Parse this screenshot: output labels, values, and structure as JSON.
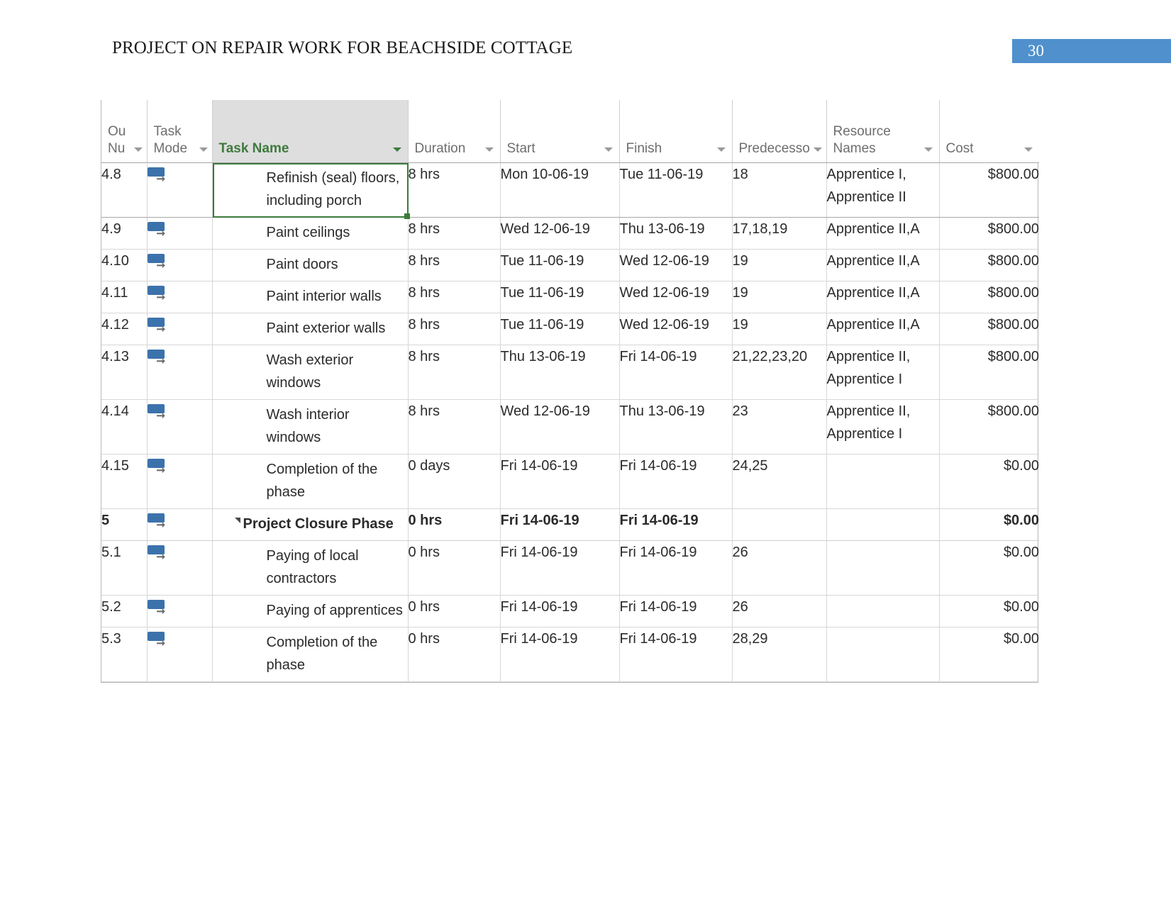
{
  "header": {
    "doc_title": "PROJECT ON REPAIR WORK FOR BEACHSIDE COTTAGE",
    "page_number": "30",
    "page_bar_color": "#4f90cd"
  },
  "table": {
    "selected_column": "Task Name",
    "selection_color": "#3b7a3b",
    "columns": [
      {
        "key": "outline",
        "label": "Ou\nNu",
        "has_filter": true
      },
      {
        "key": "task_mode",
        "label": "Task\nMode",
        "has_filter": true
      },
      {
        "key": "task_name",
        "label": "Task Name",
        "has_filter": true,
        "selected": true
      },
      {
        "key": "duration",
        "label": "Duration",
        "has_filter": true
      },
      {
        "key": "start",
        "label": "Start",
        "has_filter": true
      },
      {
        "key": "finish",
        "label": "Finish",
        "has_filter": true
      },
      {
        "key": "predecessor",
        "label": "Predecesso",
        "has_filter": true
      },
      {
        "key": "resources",
        "label": "Resource\nNames",
        "has_filter": true
      },
      {
        "key": "cost",
        "label": "Cost",
        "has_filter": true
      }
    ],
    "rows": [
      {
        "outline": "4.8",
        "mode_icon": "auto-schedule-icon",
        "task_name": "Refinish (seal) floors, including porch",
        "duration": "8 hrs",
        "start": "Mon 10-06-19",
        "finish": "Tue 11-06-19",
        "predecessor": "18",
        "resources": "Apprentice I, Apprentice II",
        "cost": "$800.00",
        "selected": true,
        "summary": false
      },
      {
        "outline": "4.9",
        "mode_icon": "auto-schedule-icon",
        "task_name": "Paint ceilings",
        "duration": "8 hrs",
        "start": "Wed 12-06-19",
        "finish": "Thu 13-06-19",
        "predecessor": "17,18,19",
        "resources": "Apprentice II,A",
        "cost": "$800.00",
        "selected": false,
        "summary": false
      },
      {
        "outline": "4.10",
        "mode_icon": "auto-schedule-icon",
        "task_name": "Paint doors",
        "duration": "8 hrs",
        "start": "Tue 11-06-19",
        "finish": "Wed 12-06-19",
        "predecessor": "19",
        "resources": "Apprentice II,A",
        "cost": "$800.00",
        "selected": false,
        "summary": false
      },
      {
        "outline": "4.11",
        "mode_icon": "auto-schedule-icon",
        "task_name": "Paint interior walls",
        "duration": "8 hrs",
        "start": "Tue 11-06-19",
        "finish": "Wed 12-06-19",
        "predecessor": "19",
        "resources": "Apprentice II,A",
        "cost": "$800.00",
        "selected": false,
        "summary": false
      },
      {
        "outline": "4.12",
        "mode_icon": "auto-schedule-icon",
        "task_name": "Paint exterior walls",
        "duration": "8 hrs",
        "start": "Tue 11-06-19",
        "finish": "Wed 12-06-19",
        "predecessor": "19",
        "resources": "Apprentice II,A",
        "cost": "$800.00",
        "selected": false,
        "summary": false
      },
      {
        "outline": "4.13",
        "mode_icon": "auto-schedule-icon",
        "task_name": "Wash exterior windows",
        "duration": "8 hrs",
        "start": "Thu 13-06-19",
        "finish": "Fri 14-06-19",
        "predecessor": "21,22,23,20",
        "resources": "Apprentice II, Apprentice I",
        "cost": "$800.00",
        "selected": false,
        "summary": false
      },
      {
        "outline": "4.14",
        "mode_icon": "auto-schedule-icon",
        "task_name": "Wash interior windows",
        "duration": "8 hrs",
        "start": "Wed 12-06-19",
        "finish": "Thu 13-06-19",
        "predecessor": "23",
        "resources": "Apprentice II, Apprentice I",
        "cost": "$800.00",
        "selected": false,
        "summary": false
      },
      {
        "outline": "4.15",
        "mode_icon": "auto-schedule-icon",
        "task_name": "Completion of the phase",
        "duration": "0 days",
        "start": "Fri 14-06-19",
        "finish": "Fri 14-06-19",
        "predecessor": "24,25",
        "resources": "",
        "cost": "$0.00",
        "selected": false,
        "summary": false
      },
      {
        "outline": "5",
        "mode_icon": "auto-schedule-icon",
        "task_name": "Project Closure Phase",
        "duration": "0 hrs",
        "start": "Fri 14-06-19",
        "finish": "Fri 14-06-19",
        "predecessor": "",
        "resources": "",
        "cost": "$0.00",
        "selected": false,
        "summary": true
      },
      {
        "outline": "5.1",
        "mode_icon": "auto-schedule-icon",
        "task_name": "Paying of local contractors",
        "duration": "0 hrs",
        "start": "Fri 14-06-19",
        "finish": "Fri 14-06-19",
        "predecessor": "26",
        "resources": "",
        "cost": "$0.00",
        "selected": false,
        "summary": false
      },
      {
        "outline": "5.2",
        "mode_icon": "auto-schedule-icon",
        "task_name": "Paying of apprentices",
        "duration": "0 hrs",
        "start": "Fri 14-06-19",
        "finish": "Fri 14-06-19",
        "predecessor": "26",
        "resources": "",
        "cost": "$0.00",
        "selected": false,
        "summary": false
      },
      {
        "outline": "5.3",
        "mode_icon": "auto-schedule-icon",
        "task_name": "Completion of the phase",
        "duration": "0 hrs",
        "start": "Fri 14-06-19",
        "finish": "Fri 14-06-19",
        "predecessor": "28,29",
        "resources": "",
        "cost": "$0.00",
        "selected": false,
        "summary": false
      }
    ]
  }
}
